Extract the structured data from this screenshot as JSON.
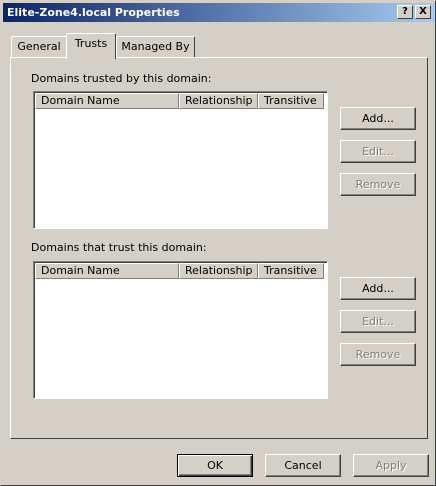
{
  "window": {
    "title": "Elite-Zone4.local Properties",
    "help_label": "?",
    "close_label": "X"
  },
  "tabs": [
    {
      "label": "General",
      "selected": false
    },
    {
      "label": "Trusts",
      "selected": true
    },
    {
      "label": "Managed By",
      "selected": false
    }
  ],
  "trusted_by": {
    "label": "Domains trusted by this domain:",
    "columns": [
      "Domain Name",
      "Relationship",
      "Transitive"
    ],
    "rows": [],
    "buttons": {
      "add": "Add...",
      "edit": "Edit...",
      "remove": "Remove"
    }
  },
  "trusting": {
    "label": "Domains that trust this domain:",
    "columns": [
      "Domain Name",
      "Relationship",
      "Transitive"
    ],
    "rows": [],
    "buttons": {
      "add": "Add...",
      "edit": "Edit...",
      "remove": "Remove"
    }
  },
  "footer": {
    "ok": "OK",
    "cancel": "Cancel",
    "apply": "Apply"
  },
  "colors": {
    "titlebar_start": "#0a246a",
    "titlebar_end": "#a6caf0",
    "face": "#d4d0c8"
  }
}
